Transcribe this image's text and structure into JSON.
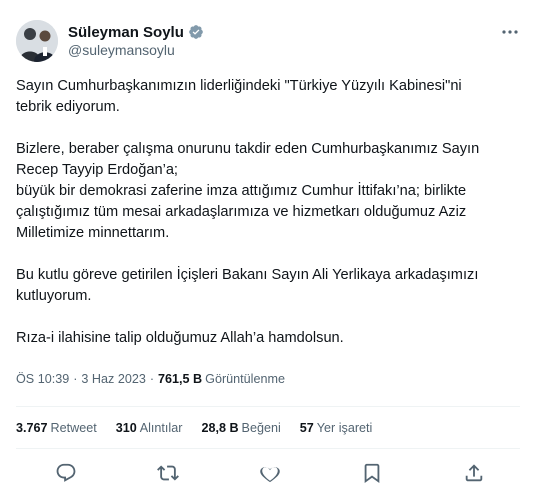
{
  "author": {
    "display_name": "Süleyman Soylu",
    "handle": "@suleymansoylu"
  },
  "icons": {
    "avatar": "profile-photo",
    "verified": "verified-badge-icon",
    "more": "more-horizontal-icon",
    "reply": "reply-icon",
    "retweet": "retweet-icon",
    "like": "heart-icon",
    "bookmark": "bookmark-icon",
    "share": "share-icon"
  },
  "colors": {
    "text": "#0f1419",
    "muted": "#536471",
    "verified_blue": "#1d9bf0",
    "divider": "#eff3f4"
  },
  "tweet": {
    "p1_l1": "Sayın Cumhurbaşkanımızın liderliğindeki \"Türkiye Yüzyılı Kabinesi\"ni",
    "p1_l2": "tebrik ediyorum.",
    "p2_l1": "Bizlere, beraber çalışma onurunu takdir eden Cumhurbaşkanımız Sayın",
    "p2_l2": "Recep Tayyip Erdoğan’a;",
    "p2_l3": "büyük bir demokrasi zaferine imza attığımız Cumhur İttifakı’na; birlikte",
    "p2_l4": "çalıştığımız tüm mesai arkadaşlarımıza ve hizmetkarı olduğumuz Aziz",
    "p2_l5": "Milletimize minnettarım.",
    "p3_l1": "Bu kutlu göreve getirilen İçişleri Bakanı Sayın Ali Yerlikaya arkadaşımızı",
    "p3_l2": "kutluyorum.",
    "p4_l1": "Rıza-i ilahisine talip olduğumuz Allah’a hamdolsun."
  },
  "meta": {
    "time": "ÖS 10:39",
    "date": "3 Haz 2023",
    "separator": "·",
    "views_count": "761,5 B",
    "views_label": "Görüntülenme"
  },
  "stats": {
    "retweets_count": "3.767",
    "retweets_label": "Retweet",
    "quotes_count": "310",
    "quotes_label": "Alıntılar",
    "likes_count": "28,8 B",
    "likes_label": "Beğeni",
    "bookmarks_count": "57",
    "bookmarks_label": "Yer işareti"
  }
}
